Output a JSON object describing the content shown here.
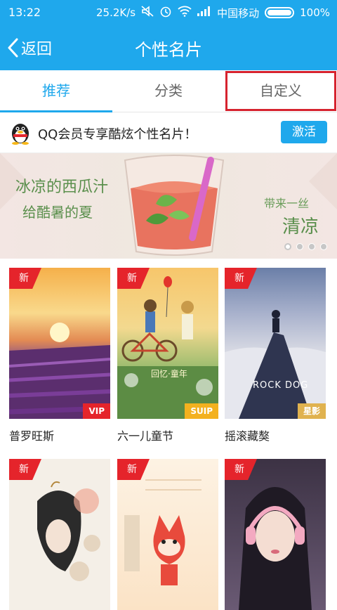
{
  "status_bar": {
    "time": "13:22",
    "speed": "25.2K/s",
    "carrier": "中国移动",
    "battery": "100%"
  },
  "nav": {
    "back_label": "返回",
    "title": "个性名片"
  },
  "tabs": [
    {
      "label": "推荐",
      "active": true
    },
    {
      "label": "分类",
      "active": false
    },
    {
      "label": "自定义",
      "active": false
    }
  ],
  "promo": {
    "text": "QQ会员专享酷炫个性名片！",
    "button": "激活"
  },
  "banner": {
    "line1": "冰凉的西瓜汁",
    "line2": "给酷暑的夏",
    "line3": "带来一丝",
    "line4": "清凉"
  },
  "cards": [
    {
      "name": "普罗旺斯",
      "badge": "新",
      "tier": "VIP"
    },
    {
      "name": "六一儿童节",
      "badge": "新",
      "tier": "SUIP",
      "img_text": "回忆·童年"
    },
    {
      "name": "摇滚藏獒",
      "badge": "新",
      "tier": "星影",
      "img_text": "ROCK DOG"
    },
    {
      "name": "",
      "badge": "新",
      "tier": ""
    },
    {
      "name": "",
      "badge": "新",
      "tier": ""
    },
    {
      "name": "",
      "badge": "新",
      "tier": ""
    }
  ],
  "colors": {
    "accent": "#1fa8ec",
    "highlight_box": "#d6232f",
    "new_badge": "#e5242b"
  }
}
